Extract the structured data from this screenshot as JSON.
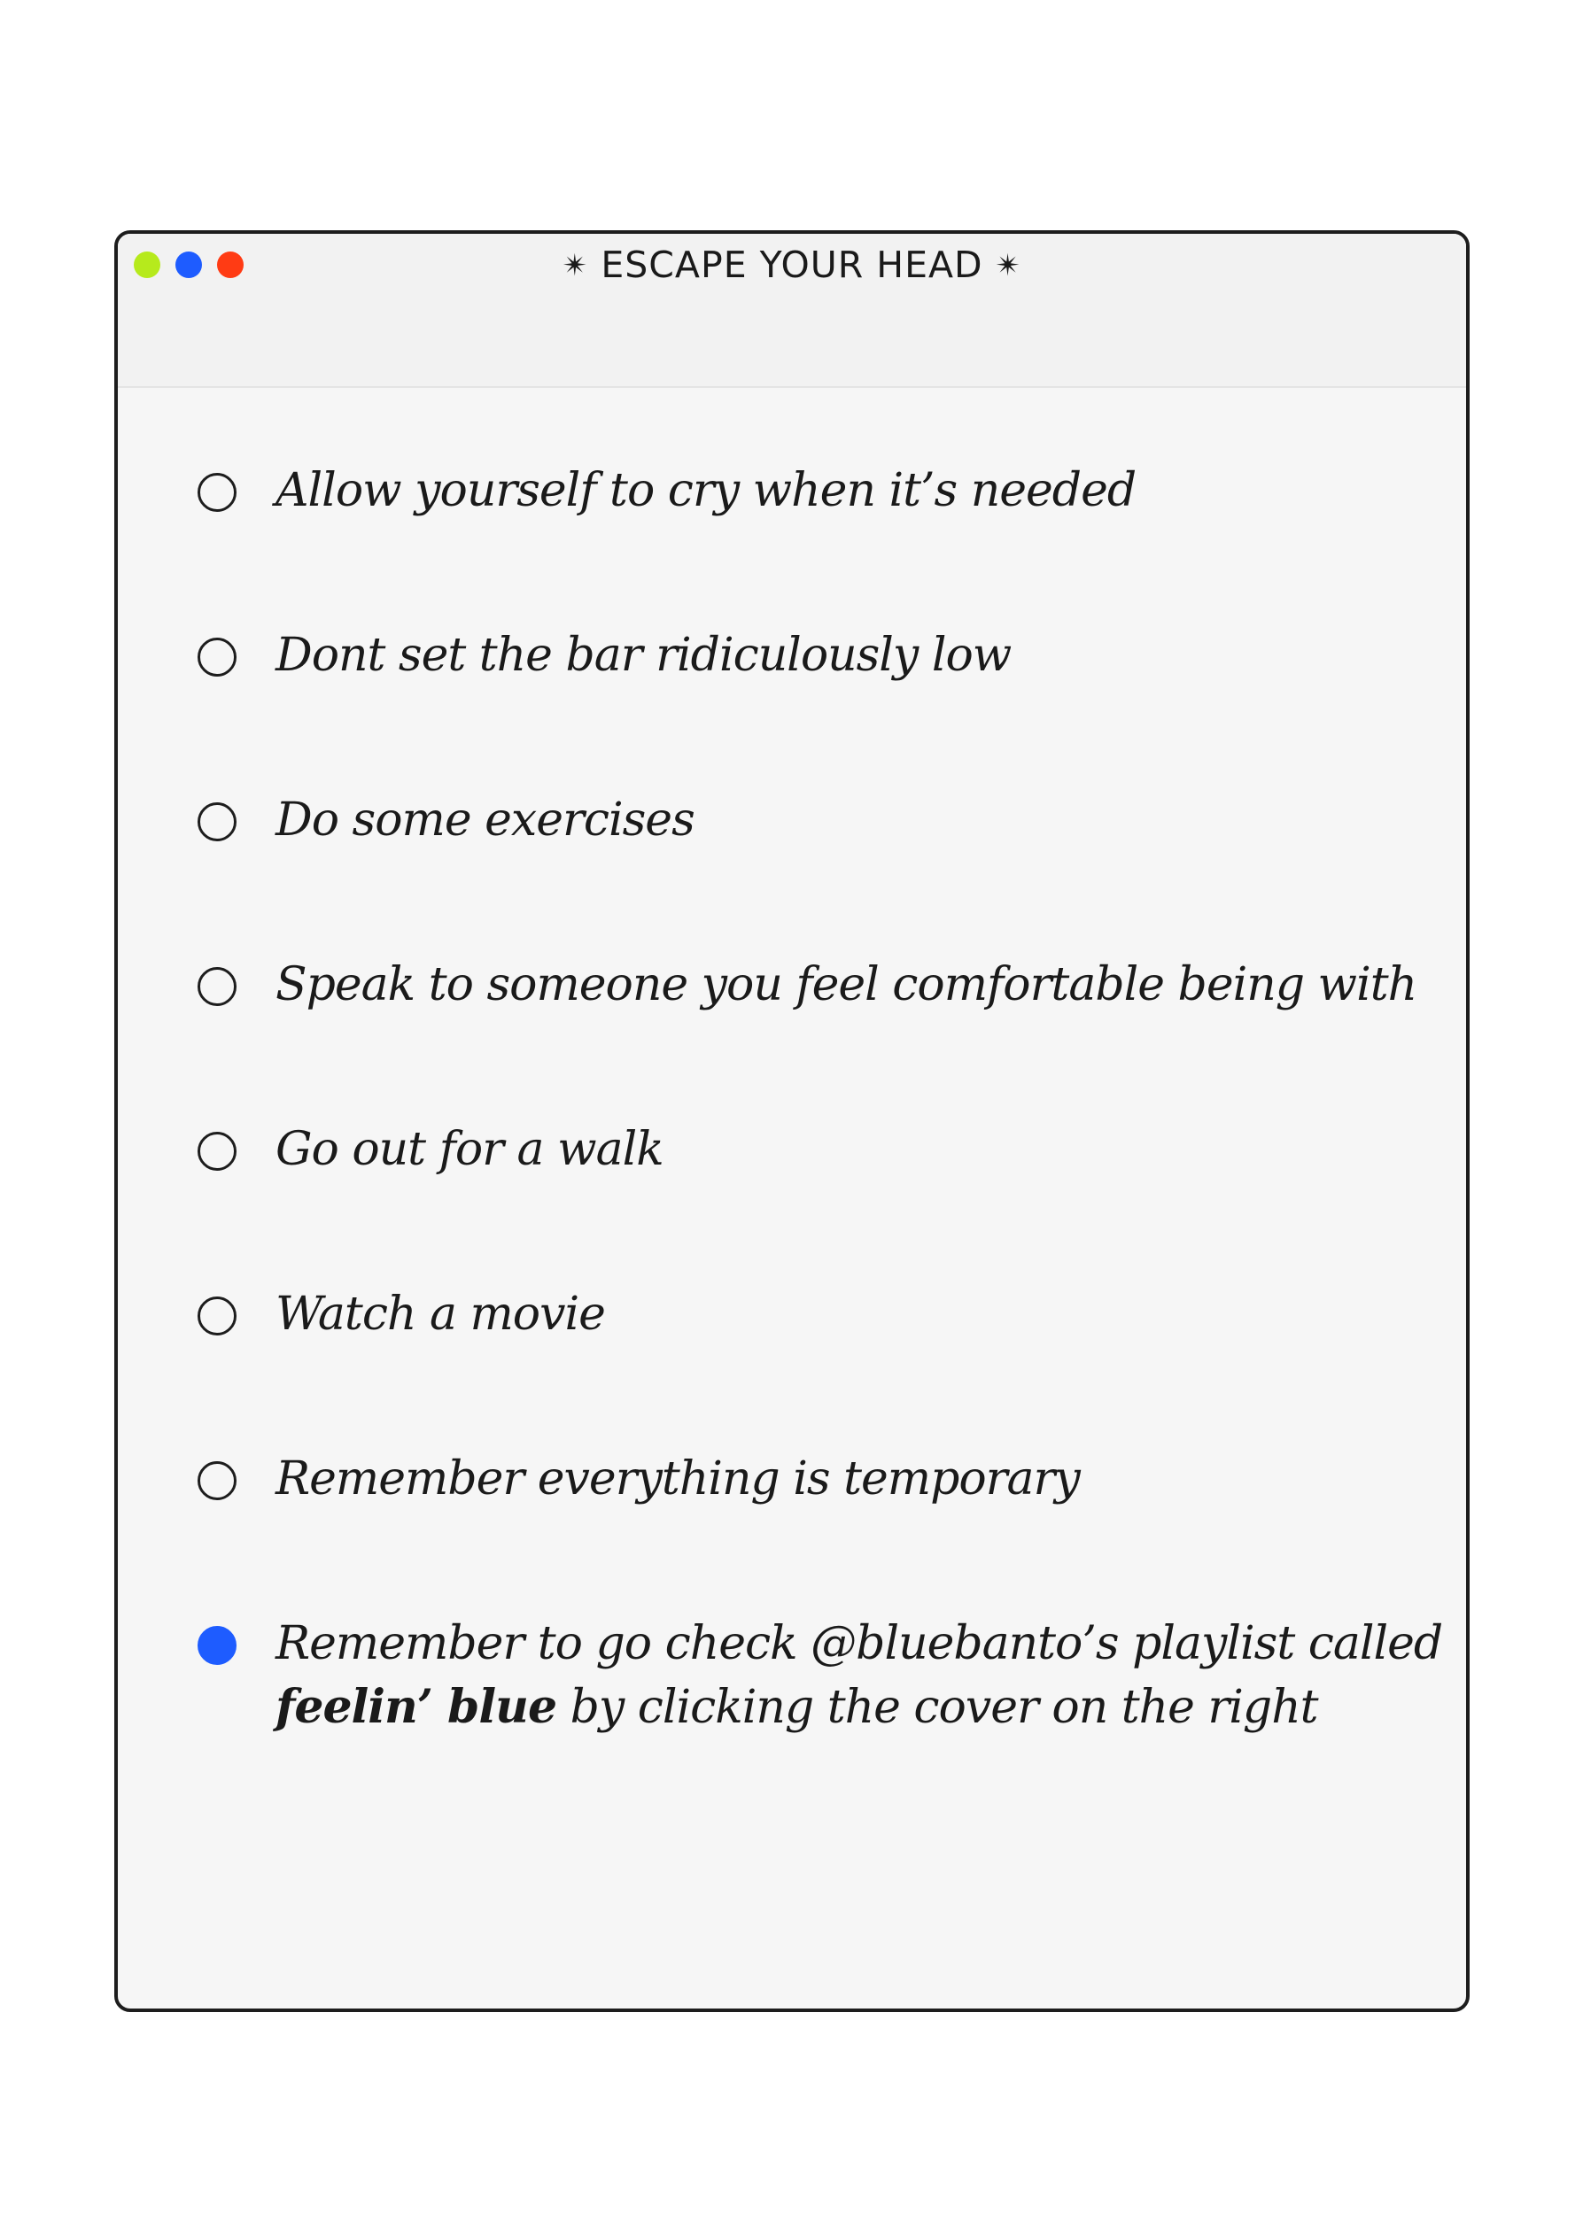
{
  "window": {
    "title": "ESCAPE YOUR HEAD",
    "star_left": "✴",
    "star_right": "✴",
    "dots": [
      {
        "name": "green-dot",
        "color": "#b6ea1c"
      },
      {
        "name": "blue-dot",
        "color": "#1e5cff"
      },
      {
        "name": "red-dot",
        "color": "#ff3b14"
      }
    ]
  },
  "items": [
    {
      "label": "Allow yourself to cry when it’s needed",
      "checked": false
    },
    {
      "label": "Dont set the bar ridiculously low",
      "checked": false
    },
    {
      "label": "Do some exercises",
      "checked": false
    },
    {
      "label": "Speak to someone you feel comfortable being with",
      "checked": false
    },
    {
      "label": "Go out for a walk",
      "checked": false
    },
    {
      "label": "Watch a movie",
      "checked": false
    },
    {
      "label": "Remember everything is temporary",
      "checked": false
    },
    {
      "label_line1": "Remember to go check @bluebanto’s playlist called",
      "label_bold": "feelin’ blue",
      "label_line2_rest": " by clicking the cover on the right",
      "checked": true
    }
  ],
  "colors": {
    "accent": "#1e5cff",
    "border": "#1d1d1d",
    "background": "#f6f6f6"
  }
}
